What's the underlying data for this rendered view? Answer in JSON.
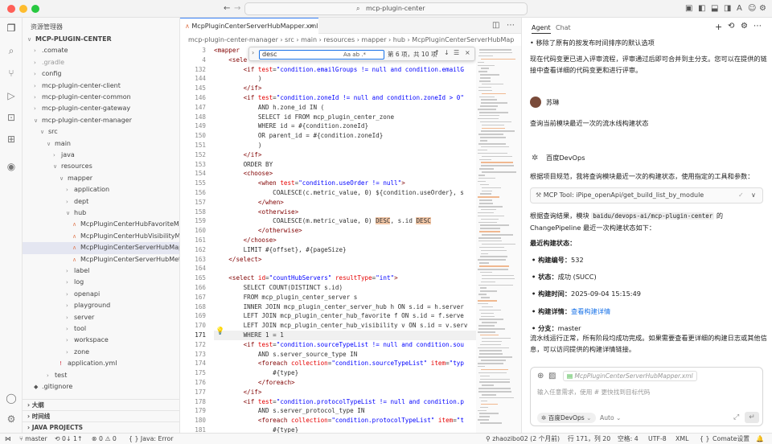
{
  "window": {
    "search": "mcp-plugin-center"
  },
  "sidebar": {
    "title": "资源管理器",
    "items": [
      {
        "label": "MCP-PLUGIN-CENTER",
        "indent": 0,
        "chev": "∨",
        "bold": true
      },
      {
        "label": ".comate",
        "indent": 1,
        "chev": "›"
      },
      {
        "label": ".gradle",
        "indent": 1,
        "chev": "›",
        "dim": true
      },
      {
        "label": "config",
        "indent": 1,
        "chev": "›"
      },
      {
        "label": "mcp-plugin-center-client",
        "indent": 1,
        "chev": "›"
      },
      {
        "label": "mcp-plugin-center-common",
        "indent": 1,
        "chev": "›"
      },
      {
        "label": "mcp-plugin-center-gateway",
        "indent": 1,
        "chev": "›"
      },
      {
        "label": "mcp-plugin-center-manager",
        "indent": 1,
        "chev": "∨"
      },
      {
        "label": "src",
        "indent": 2,
        "chev": "∨"
      },
      {
        "label": "main",
        "indent": 3,
        "chev": "∨"
      },
      {
        "label": "java",
        "indent": 4,
        "chev": "›"
      },
      {
        "label": "resources",
        "indent": 4,
        "chev": "∨"
      },
      {
        "label": "mapper",
        "indent": 5,
        "chev": "∨"
      },
      {
        "label": "application",
        "indent": 6,
        "chev": "›"
      },
      {
        "label": "dept",
        "indent": 6,
        "chev": "›"
      },
      {
        "label": "hub",
        "indent": 6,
        "chev": "∨"
      },
      {
        "label": "McpPluginCenterHubFavoriteMap...",
        "indent": 7,
        "file": true
      },
      {
        "label": "McpPluginCenterHubVisibilityMap...",
        "indent": 7,
        "file": true
      },
      {
        "label": "McpPluginCenterServerHubMapp...",
        "indent": 7,
        "file": true,
        "sel": true
      },
      {
        "label": "McpPluginCenterServerHubMetri...",
        "indent": 7,
        "file": true
      },
      {
        "label": "label",
        "indent": 6,
        "chev": "›"
      },
      {
        "label": "log",
        "indent": 6,
        "chev": "›"
      },
      {
        "label": "openapi",
        "indent": 6,
        "chev": "›"
      },
      {
        "label": "playground",
        "indent": 6,
        "chev": "›"
      },
      {
        "label": "server",
        "indent": 6,
        "chev": "›"
      },
      {
        "label": "tool",
        "indent": 6,
        "chev": "›"
      },
      {
        "label": "workspace",
        "indent": 6,
        "chev": "›"
      },
      {
        "label": "zone",
        "indent": 6,
        "chev": "›"
      },
      {
        "label": "application.yml",
        "indent": 5,
        "yml": true
      },
      {
        "label": "test",
        "indent": 3,
        "chev": "›"
      },
      {
        "label": ".gitignore",
        "indent": 1,
        "git": true
      }
    ],
    "sections": [
      "大纲",
      "时间线",
      "JAVA PROJECTS"
    ]
  },
  "editor": {
    "tab": "McpPluginCenterServerHubMapper.xml",
    "breadcrumb": "mcp-plugin-center-manager  ›  src  ›  main  ›  resources  ›  mapper  ›  hub  ›  McpPluginCenterServerHubMap",
    "find": {
      "query": "desc",
      "options": "Aa  ab  .*",
      "count": "第 6 项，共 10 项"
    },
    "lines": [
      {
        "n": "3",
        "h": "<span class=\"tag\">&lt;mapper</span> "
      },
      {
        "n": "4",
        "h": "    <span class=\"tag\">&lt;sele</span>"
      },
      {
        "n": "132",
        "h": "        <span class=\"tag\">&lt;if</span> <span class=\"att\">test</span>=<span class=\"str\">\"condition.emailGroups != null and condition.emailG</span>"
      },
      {
        "n": "144",
        "h": "            )"
      },
      {
        "n": "145",
        "h": "        <span class=\"tag\">&lt;/if&gt;</span>"
      },
      {
        "n": "146",
        "h": "        <span class=\"tag\">&lt;if</span> <span class=\"att\">test</span>=<span class=\"str\">\"condition.zoneId != null and condition.zoneId &gt; 0\"</span>"
      },
      {
        "n": "147",
        "h": "            AND h.zone_id IN ("
      },
      {
        "n": "148",
        "h": "            SELECT id FROM mcp_plugin_center_zone"
      },
      {
        "n": "149",
        "h": "            WHERE id = #{condition.zoneId}"
      },
      {
        "n": "150",
        "h": "            OR parent_id = #{condition.zoneId}"
      },
      {
        "n": "151",
        "h": "            )"
      },
      {
        "n": "152",
        "h": "        <span class=\"tag\">&lt;/if&gt;</span>"
      },
      {
        "n": "153",
        "h": "        ORDER BY"
      },
      {
        "n": "154",
        "h": "        <span class=\"tag\">&lt;choose&gt;</span>"
      },
      {
        "n": "155",
        "h": "            <span class=\"tag\">&lt;when</span> <span class=\"att\">test</span>=<span class=\"str\">\"condition.useOrder != null\"</span><span class=\"tag\">&gt;</span>"
      },
      {
        "n": "156",
        "h": "                COALESCE(c.metric_value, 0) ${condition.useOrder}, s"
      },
      {
        "n": "157",
        "h": "            <span class=\"tag\">&lt;/when&gt;</span>"
      },
      {
        "n": "158",
        "h": "            <span class=\"tag\">&lt;otherwise&gt;</span>"
      },
      {
        "n": "159",
        "h": "                COALESCE(m.metric_value, 0) <span class=\"hl\">DESC</span>, s.id <span class=\"hl\">DESC</span>"
      },
      {
        "n": "160",
        "h": "            <span class=\"tag\">&lt;/otherwise&gt;</span>"
      },
      {
        "n": "161",
        "h": "        <span class=\"tag\">&lt;/choose&gt;</span>"
      },
      {
        "n": "162",
        "h": "        LIMIT #{offset}, #{pageSize}"
      },
      {
        "n": "163",
        "h": "    <span class=\"tag\">&lt;/select&gt;</span>"
      },
      {
        "n": "164",
        "h": ""
      },
      {
        "n": "165",
        "h": "    <span class=\"tag\">&lt;select</span> <span class=\"att\">id</span>=<span class=\"str\">\"countHubServers\"</span> <span class=\"att\">resultType</span>=<span class=\"str\">\"int\"</span><span class=\"tag\">&gt;</span>"
      },
      {
        "n": "166",
        "h": "        SELECT COUNT(DISTINCT s.id)"
      },
      {
        "n": "167",
        "h": "        FROM mcp_plugin_center_server s"
      },
      {
        "n": "168",
        "h": "        INNER JOIN mcp_plugin_center_server_hub h ON s.id = h.server"
      },
      {
        "n": "169",
        "h": "        LEFT JOIN mcp_plugin_center_hub_favorite f ON s.id = f.serve"
      },
      {
        "n": "170",
        "h": "        LEFT JOIN mcp_plugin_center_hub_visibility v ON s.id = v.serv"
      },
      {
        "n": "171",
        "h": "        WHERE 1 = 1",
        "cur": true
      },
      {
        "n": "172",
        "h": "        <span class=\"tag\">&lt;if</span> <span class=\"att\">test</span>=<span class=\"str\">\"condition.sourceTypeList != null and condition.sou</span>"
      },
      {
        "n": "173",
        "h": "            AND s.server_source_type IN"
      },
      {
        "n": "174",
        "h": "            <span class=\"tag\">&lt;foreach</span> <span class=\"att\">collection</span>=<span class=\"str\">\"condition.sourceTypeList\"</span> <span class=\"att\">item</span>=<span class=\"str\">\"typ</span>"
      },
      {
        "n": "175",
        "h": "                #{type}"
      },
      {
        "n": "176",
        "h": "            <span class=\"tag\">&lt;/foreach&gt;</span>"
      },
      {
        "n": "177",
        "h": "        <span class=\"tag\">&lt;/if&gt;</span>"
      },
      {
        "n": "178",
        "h": "        <span class=\"tag\">&lt;if</span> <span class=\"att\">test</span>=<span class=\"str\">\"condition.protocolTypeList != null and condition.p</span>"
      },
      {
        "n": "179",
        "h": "            AND s.server_protocol_type IN"
      },
      {
        "n": "180",
        "h": "            <span class=\"tag\">&lt;foreach</span> <span class=\"att\">collection</span>=<span class=\"str\">\"condition.protocolTypeList\"</span> <span class=\"att\">item</span>=<span class=\"str\">\"t</span>"
      },
      {
        "n": "181",
        "h": "                #{type}"
      }
    ]
  },
  "panel": {
    "tabs": [
      "Agent",
      "Chat"
    ],
    "top_bullet": "移除了原有的按发布时间排序的默认选项",
    "summary": "现在代码变更已进入评审流程，评审通过后即可合并到主分支。您可以在提供的链接中查看详细的代码变更和进行评审。",
    "user_name": "苏琳",
    "user_msg": "查询当前模块最近一次的流水线构建状态",
    "bot_name": "百度DevOps",
    "bot_intro": "根据项目规范，我将查询模块最近一次的构建状态，使用指定的工具和参数：",
    "mcp_tool": "MCP Tool:  iPipe_openApi/get_build_list_by_module",
    "result_pre": "根据查询结果，模块 ",
    "result_code": "baidu/devops-ai/mcp-plugin-center",
    "result_post": " 的 ChangePipeline 最近一次构建状态如下：",
    "status_title": "最近构建状态：",
    "bullets": [
      {
        "k": "构建编号：",
        "v": "532"
      },
      {
        "k": "状态：",
        "v": "成功 (SUCC)"
      },
      {
        "k": "构建时间：",
        "v": "2025-09-04 15:15:49"
      },
      {
        "k": "构建详情：",
        "v": "查看构建详情",
        "link": true
      },
      {
        "k": "分支：",
        "v": "master"
      }
    ],
    "closing": "流水线运行正常，所有阶段均成功完成。如果需要查看更详细的构建日志或其他信息，可以访问提供的构建详情链接。",
    "input": {
      "file_chip": "McpPluginCenterServerHubMapper.xml",
      "placeholder": "输入任意需求，使用 # 更快找到目标代码",
      "agent": "百度DevOps",
      "mode": "Auto"
    }
  },
  "status": {
    "branch": "master",
    "sync": "⟲ 0↓ 1↑",
    "problems": "⊗ 0  ⚠ 0",
    "java": "Java: Error",
    "blame": "zhaozibo02 (2 个月前)",
    "pos": "行 171，列 20",
    "spaces": "空格: 4",
    "enc": "UTF-8",
    "lang": "XML",
    "comate": "Comate设置"
  }
}
